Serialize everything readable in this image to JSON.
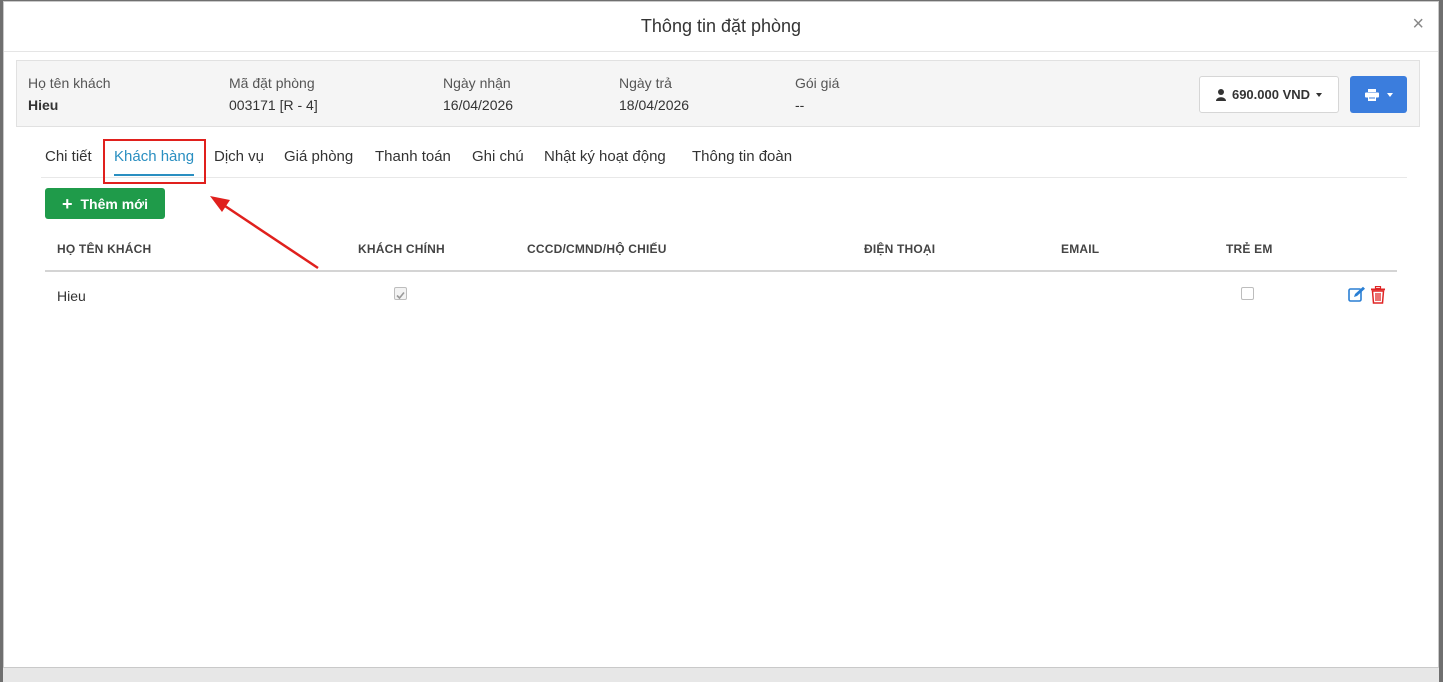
{
  "modal": {
    "title": "Thông tin đặt phòng",
    "close_label": "×"
  },
  "info": {
    "guest_name_label": "Họ tên khách",
    "guest_name_value": "Hieu",
    "booking_code_label": "Mã đặt phòng",
    "booking_code_value": "003171 [R - 4]",
    "checkin_label": "Ngày nhận",
    "checkin_value": "16/04/2026",
    "checkout_label": "Ngày trả",
    "checkout_value": "18/04/2026",
    "rate_label": "Gói giá",
    "rate_value": "--",
    "price_button": "690.000 VND"
  },
  "tabs": [
    {
      "label": "Chi tiết"
    },
    {
      "label": "Khách hàng"
    },
    {
      "label": "Dịch vụ"
    },
    {
      "label": "Giá phòng"
    },
    {
      "label": "Thanh toán"
    },
    {
      "label": "Ghi chú"
    },
    {
      "label": "Nhật ký hoạt động"
    },
    {
      "label": "Thông tin đoàn"
    }
  ],
  "active_tab": "Khách hàng",
  "add_button": "Thêm mới",
  "table": {
    "headers": [
      "HỌ TÊN KHÁCH",
      "KHÁCH CHÍNH",
      "CCCD/CMND/HỘ CHIẾU",
      "ĐIỆN THOẠI",
      "EMAIL",
      "TRẺ EM"
    ],
    "rows": [
      {
        "name": "Hieu",
        "main_guest": true,
        "id_number": "",
        "phone": "",
        "email": "",
        "child": false
      }
    ]
  },
  "colors": {
    "accent_blue": "#2a8fc1",
    "print_button": "#3b7ddd",
    "add_button": "#1f9b4a",
    "annotation_red": "#e0201d",
    "delete_red": "#e02525"
  }
}
